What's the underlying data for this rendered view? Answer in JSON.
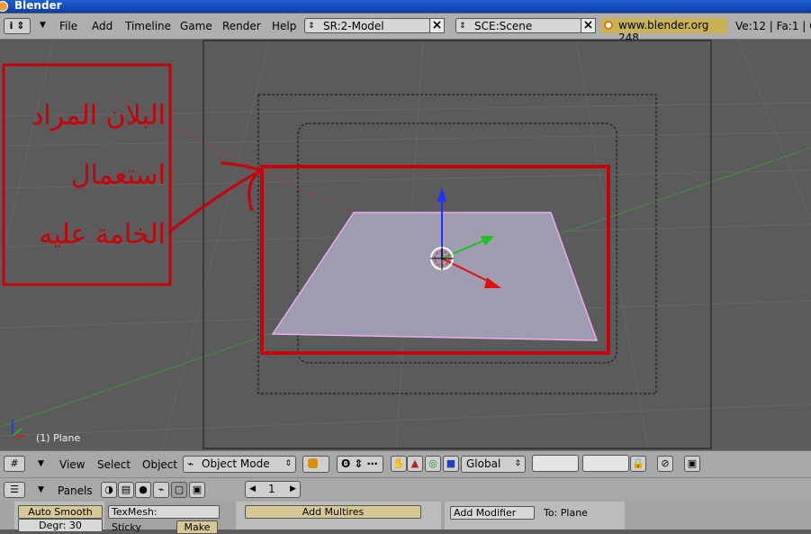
{
  "window": {
    "title": "Blender"
  },
  "menu": {
    "items": [
      "File",
      "Add",
      "Timeline",
      "Game",
      "Render",
      "Help"
    ],
    "screen_field": "SR:2-Model",
    "scene_field": "SCE:Scene",
    "website": "www.blender.org 248",
    "stats": "Ve:12 | Fa:1 | C"
  },
  "viewport": {
    "object_label": "(1) Plane",
    "annotation": {
      "line1": "البلان المراد",
      "line2": "استعمال",
      "line3": "الخامة عليه"
    }
  },
  "view3d_header": {
    "view": "View",
    "select": "Select",
    "object": "Object",
    "mode": "Object Mode",
    "orientation": "Global"
  },
  "buttons_header": {
    "panels": "Panels",
    "frame": "1"
  },
  "buttons_panel": {
    "auto_smooth": "Auto Smooth",
    "degr": "Degr: 30",
    "texmesh": "TexMesh:",
    "sticky": "Sticky",
    "make": "Make",
    "add_multires": "Add Multires",
    "add_modifier": "Add Modifier",
    "to_plane": "To: Plane"
  },
  "colors": {
    "annotation": "#c8000a",
    "plane_fill": "#a09cb0",
    "plane_edge": "#f0a8f0",
    "header_bg": "#afafaf"
  }
}
